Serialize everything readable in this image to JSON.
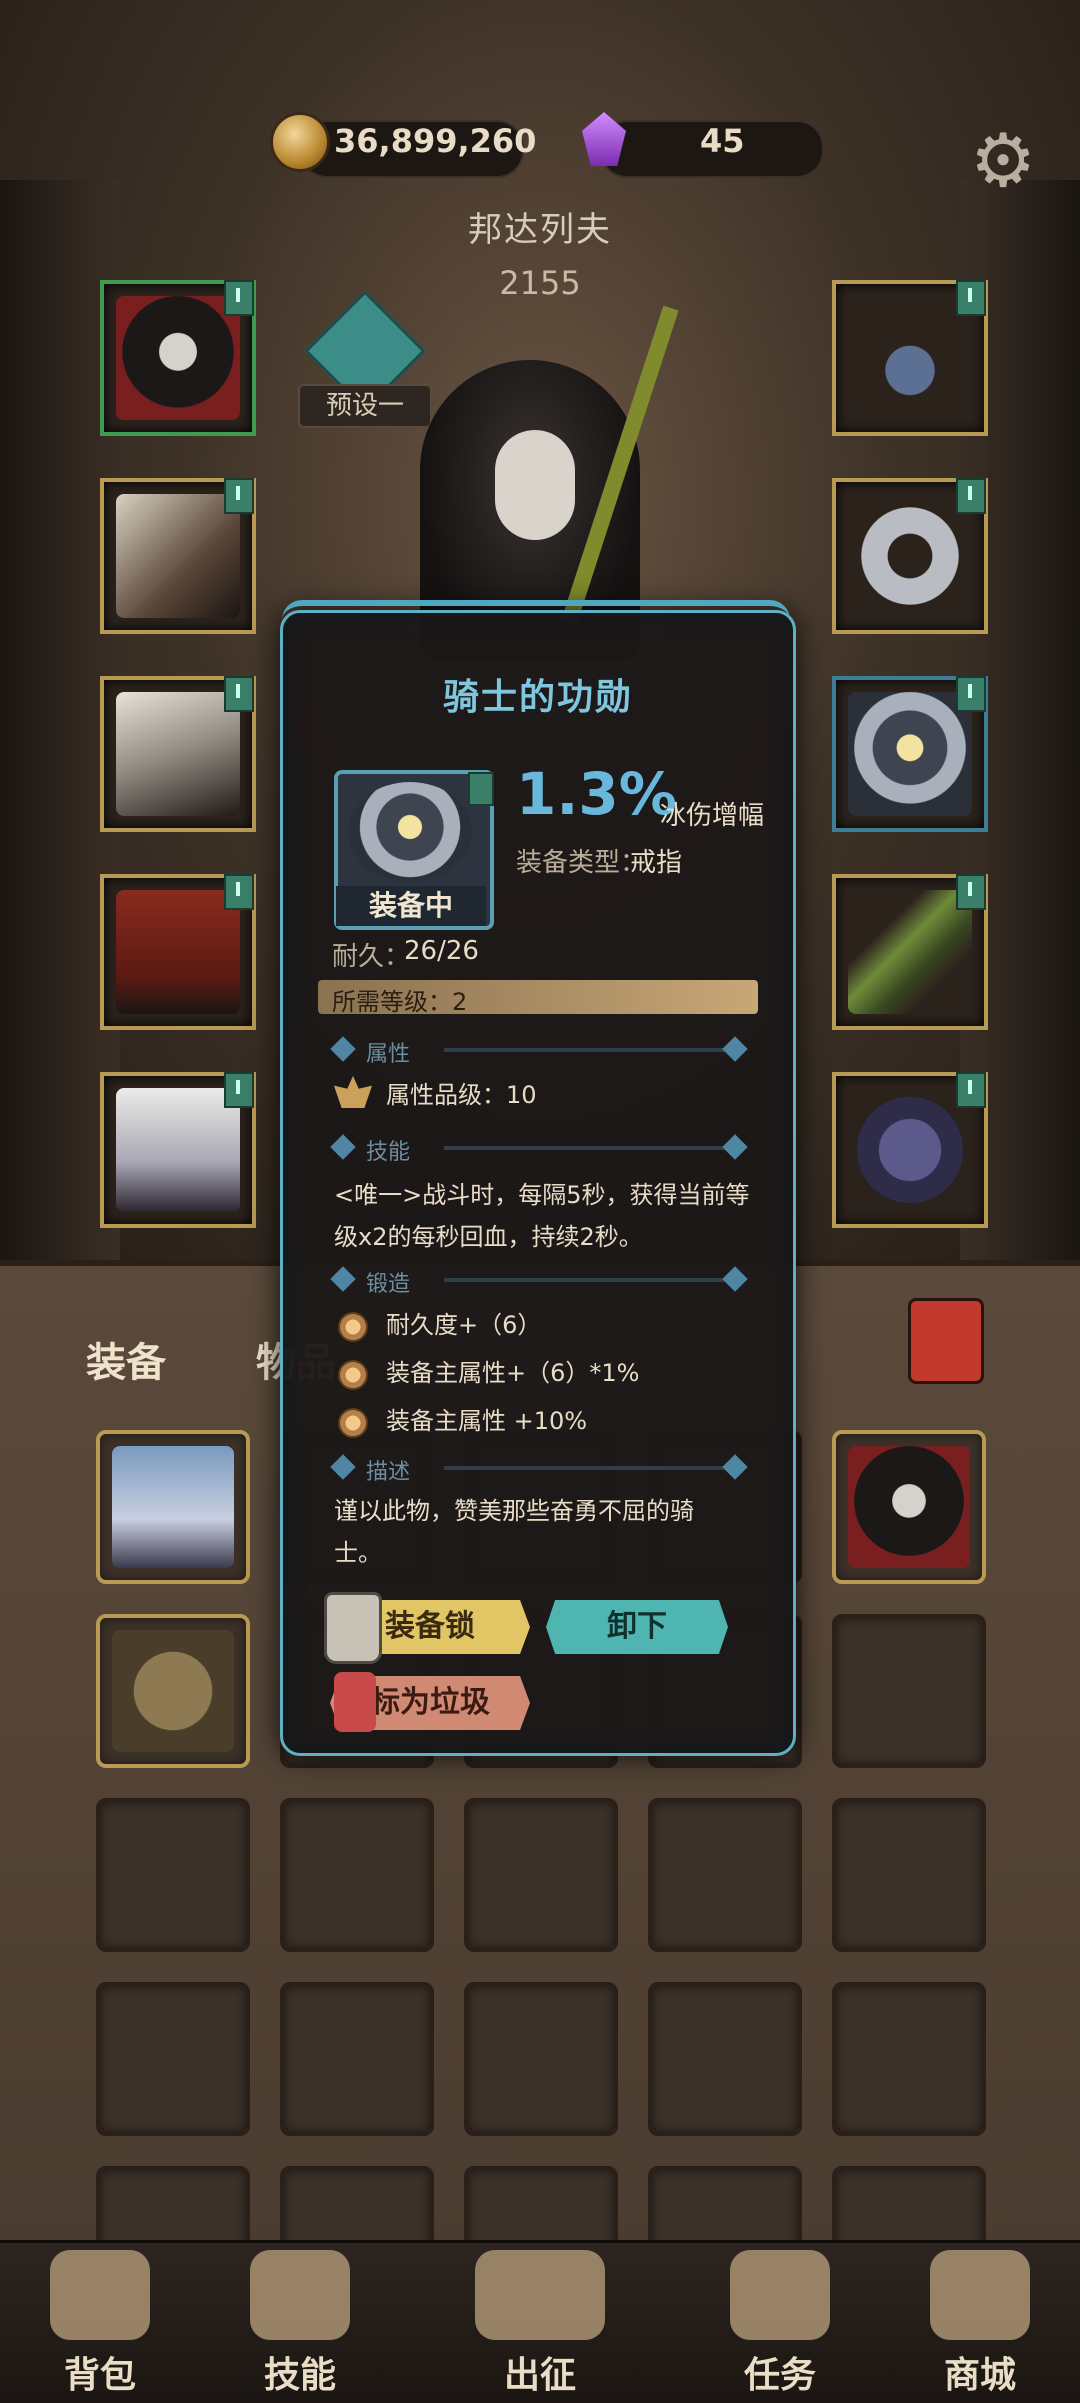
{
  "currency": {
    "gold": "36,899,260",
    "gems": "45"
  },
  "hero": {
    "name": "邦达列夫",
    "power": "2155",
    "preset": "预设一"
  },
  "equip_left": [
    "helmet",
    "armor",
    "gloves",
    "pants",
    "boots"
  ],
  "equip_right": [
    "necklace",
    "ring",
    "ring",
    "weapon",
    "offhand"
  ],
  "tabs": {
    "equip": "装备",
    "items": "物品"
  },
  "tooltip": {
    "title": "骑士的功勋",
    "equipped": "装备中",
    "main_stat": "1.3%",
    "main_stat_suffix": "冰伤增幅",
    "type_label": "装备类型：",
    "type_value": "戒指",
    "durability_label": "耐久：",
    "durability_value": "26/26",
    "required_level": "所需等级：2",
    "sec_attr": "属性",
    "attr_quality": "属性品级：10",
    "sec_skill": "技能",
    "skill_line1": "<唯一>战斗时，每隔5秒，获得当前等",
    "skill_line2": "级x2的每秒回血，持续2秒。",
    "sec_forge": "锻造",
    "forge": [
      "耐久度+（6）",
      "装备主属性+（6）*1%",
      "装备主属性 +10%"
    ],
    "sec_desc": "描述",
    "desc_line1": "谨以此物，赞美那些奋勇不屈的骑",
    "desc_line2": "士。",
    "btn_lock": "装备锁",
    "btn_unequip": "卸下",
    "btn_trash": "标为垃圾"
  },
  "nav": [
    "背包",
    "技能",
    "出征",
    "任务",
    "商城"
  ],
  "colors": {
    "accent": "#6ab7dc",
    "gold_frame": "#b89a55",
    "panel_border": "#5fb0c5"
  }
}
